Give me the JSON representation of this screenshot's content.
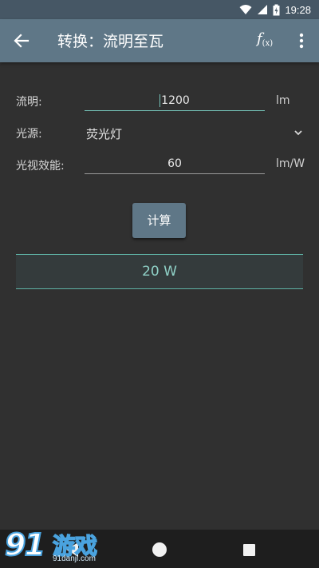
{
  "status": {
    "time": "19:28"
  },
  "appbar": {
    "title": "转换：流明至瓦",
    "fx_main": "f",
    "fx_sub": "(x)"
  },
  "form": {
    "lumen_label": "流明:",
    "lumen_value": "1200",
    "lumen_unit": "lm",
    "source_label": "光源:",
    "source_value": "荧光灯",
    "efficacy_label": "光视效能:",
    "efficacy_value": "60",
    "efficacy_unit": "lm/W"
  },
  "actions": {
    "calculate_label": "计算"
  },
  "result": {
    "value": "20 W"
  },
  "watermark": {
    "number": "91",
    "text": "游戏",
    "url": "91danji.com"
  },
  "colors": {
    "appbar": "#5f7787",
    "accent": "#74c2b8",
    "background": "#303030"
  }
}
